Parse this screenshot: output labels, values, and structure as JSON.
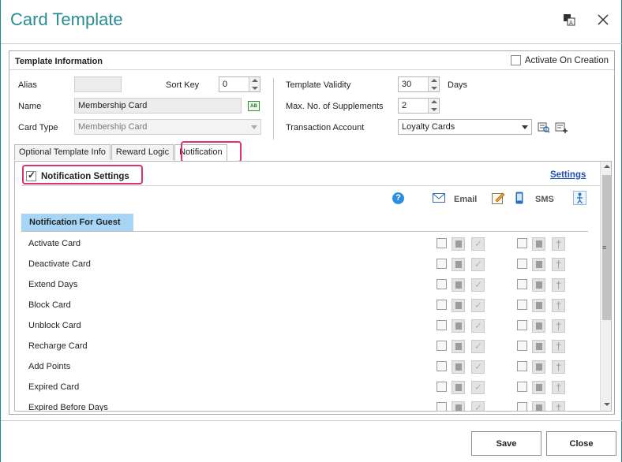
{
  "dialog": {
    "title": "Card Template"
  },
  "template_info": {
    "header": "Template Information",
    "activate_on_creation": {
      "label": "Activate On Creation",
      "checked": false
    }
  },
  "fields": {
    "alias": {
      "label": "Alias",
      "value": ""
    },
    "sort_key": {
      "label": "Sort Key",
      "value": "0"
    },
    "name": {
      "label": "Name",
      "value": "Membership Card"
    },
    "card_type": {
      "label": "Card Type",
      "value": "Membership Card"
    },
    "template_validity": {
      "label": "Template Validity",
      "value": "30",
      "unit": "Days"
    },
    "max_supplements": {
      "label": "Max. No. of Supplements",
      "value": "2"
    },
    "transaction_account": {
      "label": "Transaction Account",
      "value": "Loyalty Cards"
    }
  },
  "tabs": [
    {
      "label": "Optional Template Info",
      "active": false
    },
    {
      "label": "Reward Logic",
      "active": false
    },
    {
      "label": "Notification",
      "active": true
    }
  ],
  "notification": {
    "settings_label": "Notification Settings",
    "settings_checked": true,
    "settings_link": "Settings",
    "columns": {
      "email": "Email",
      "sms": "SMS"
    },
    "group_title": "Notification For Guest",
    "rows": [
      {
        "label": "Activate Card"
      },
      {
        "label": "Deactivate Card"
      },
      {
        "label": "Extend Days"
      },
      {
        "label": "Block Card"
      },
      {
        "label": "Unblock Card"
      },
      {
        "label": "Recharge Card"
      },
      {
        "label": "Add Points"
      },
      {
        "label": "Expired Card"
      },
      {
        "label": "Expired Before Days"
      }
    ]
  },
  "footer": {
    "save": "Save",
    "close": "Close"
  },
  "colors": {
    "accent": "#2a8b93",
    "highlight": "#e0326a",
    "group_bg": "#a7d5f5",
    "link": "#1f4fb3"
  },
  "icons": [
    "translate-icon",
    "close-icon",
    "help-icon",
    "email-icon",
    "edit-icon",
    "mobile-icon",
    "person-icon",
    "calculator-icon",
    "lookup-icon",
    "add-list-icon"
  ]
}
